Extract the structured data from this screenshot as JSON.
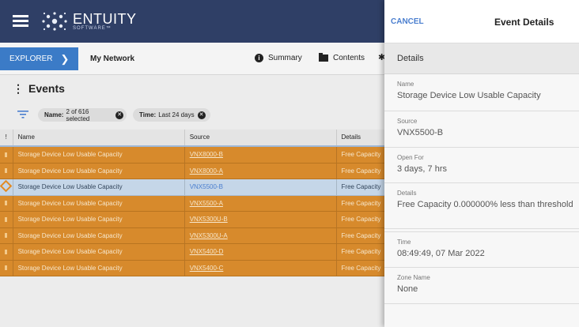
{
  "brand": {
    "name": "ENTUITY",
    "tagline": "SOFTWARE™",
    "mark_color": "#e9eef8"
  },
  "nav": {
    "explorer_label": "EXPLORER",
    "network_label": "My Network",
    "summary_label": "Summary",
    "contents_label": "Contents"
  },
  "events": {
    "title": "Events",
    "filters": [
      {
        "key": "Name:",
        "value": "2 of 616 selected"
      },
      {
        "key": "Time:",
        "value": "Last 24 days"
      }
    ],
    "columns": {
      "severity": "!",
      "name": "Name",
      "source": "Source",
      "details": "Details"
    },
    "rows": [
      {
        "name": "Storage Device Low Usable Capacity",
        "source": "VNX8000-B",
        "details": "Free Capacity",
        "state": "orange"
      },
      {
        "name": "Storage Device Low Usable Capacity",
        "source": "VNX8000-A",
        "details": "Free Capacity",
        "state": "orange"
      },
      {
        "name": "Storage Device Low Usable Capacity",
        "source": "VNX5500-B",
        "details": "Free Capacity",
        "state": "selected"
      },
      {
        "name": "Storage Device Low Usable Capacity",
        "source": "VNX5500-A",
        "details": "Free Capacity",
        "state": "orange"
      },
      {
        "name": "Storage Device Low Usable Capacity",
        "source": "VNX5300U-B",
        "details": "Free Capacity",
        "state": "orange"
      },
      {
        "name": "Storage Device Low Usable Capacity",
        "source": "VNX5300U-A",
        "details": "Free Capacity",
        "state": "orange"
      },
      {
        "name": "Storage Device Low Usable Capacity",
        "source": "VNX5400-D",
        "details": "Free Capacity",
        "state": "orange"
      },
      {
        "name": "Storage Device Low Usable Capacity",
        "source": "VNX5400-C",
        "details": "Free Capacity",
        "state": "orange"
      }
    ]
  },
  "panel": {
    "cancel_label": "CANCEL",
    "title": "Event Details",
    "section_label": "Details",
    "fields": {
      "name": {
        "label": "Name",
        "value": "Storage Device Low Usable Capacity"
      },
      "source": {
        "label": "Source",
        "value": "VNX5500-B"
      },
      "open_for": {
        "label": "Open For",
        "value": "3 days, 7 hrs"
      },
      "details": {
        "label": "Details",
        "value": "Free Capacity 0.000000% less than threshold"
      },
      "time": {
        "label": "Time",
        "value": "08:49:49, 07 Mar 2022"
      },
      "zone": {
        "label": "Zone Name",
        "value": "None"
      }
    }
  },
  "colors": {
    "header_bg": "#2f3f66",
    "accent_blue": "#3b7bc7",
    "event_orange": "#d78a2c",
    "selected_row": "#c5d6e8"
  }
}
